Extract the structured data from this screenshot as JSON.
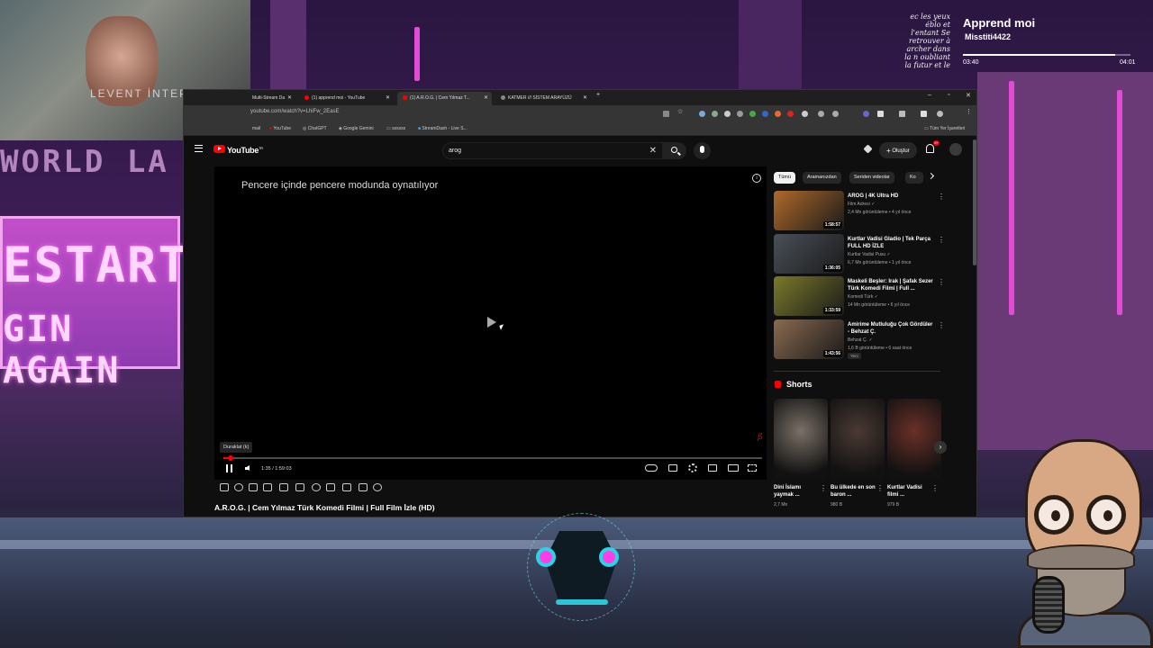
{
  "music": {
    "title": "Apprend moi",
    "artist": "Misstiti4422",
    "current_time": "03:40",
    "total_time": "04:01",
    "progress": 0.91,
    "art_text": "ec les yeux éblo et l'entant Se retrouver à archer dans la n oubliant la futur et le bruit"
  },
  "webcam": {
    "caption": "LEVENT İNTEPE"
  },
  "background": {
    "sign_line1": "ESTART",
    "sign_line2": "GIN AGAIN",
    "top_word": "WORLD LA"
  },
  "browser": {
    "tabs": [
      {
        "label": "Multi-Stream Da"
      },
      {
        "label": "(1) apprend moi - YouTube"
      },
      {
        "label": "(1) A.R.O.G. | Cem Yılmaz T..."
      },
      {
        "label": "KATMER /// SİSTEM ARAYÜZÜ"
      }
    ],
    "new_tab": "+",
    "url": "youtube.com/watch?v=LhiFw_2EasE",
    "bookmarks": [
      {
        "label": "mail"
      },
      {
        "label": "YouTube"
      },
      {
        "label": "ChatGPT"
      },
      {
        "label": "Google Gemini"
      },
      {
        "label": "ssssss"
      },
      {
        "label": "StreamDash - Live S..."
      }
    ],
    "all_bookmarks": "Tüm Yer İşaretleri"
  },
  "youtube": {
    "logo_text": "YouTube",
    "logo_sup": "TR",
    "search_query": "arog",
    "create_label": "Oluştur",
    "notif_count": "9+",
    "player": {
      "pip_message": "Pencere içinde pencere modunda oynatılıyor",
      "tooltip": "Duraklat (k)",
      "current_time": "1:35",
      "duration": "1:59:03",
      "time_display": "1:35 / 1:59:03",
      "progress": 0.013
    },
    "video_title": "A.R.O.G. | Cem Yılmaz Türk Komedi Filmi | Full Film İzle (HD)",
    "chips": [
      "Tümü",
      "Aramanızdan",
      "Seriden videolar",
      "Ko"
    ],
    "recommendations": [
      {
        "title": "AROG | 4K Ultra HD",
        "channel": "Film Adresi",
        "meta": "2,4 Mn görüntüleme • 4 yıl önce",
        "duration": "1:58:57",
        "color": "#b06a2a"
      },
      {
        "title": "Kurtlar Vadisi Gladio | Tek Parça FULL HD İZLE",
        "channel": "Kurtlar Vadisi Pusu",
        "meta": "6,7 Mn görüntüleme • 1 yıl önce",
        "duration": "1:36:05",
        "color": "#4a5058"
      },
      {
        "title": "Maskeli Beşler: Irak | Şafak Sezer Türk Komedi Filmi | Full ...",
        "channel": "Komedi Türk",
        "meta": "14 Mn görüntüleme • 6 yıl önce",
        "duration": "1:33:59",
        "color": "#7a7a2a"
      },
      {
        "title": "Amirime Mutluluğu Çok Gördüler - Behzat Ç.",
        "channel": "Behzat Ç.",
        "meta": "1,6 B görüntüleme • 6 saat önce",
        "duration": "1:43:56",
        "badge": "Yeni",
        "color": "#8a6a50"
      }
    ],
    "shorts_heading": "Shorts",
    "shorts": [
      {
        "title": "Dini İslamı yaymak ...",
        "views": "2,7 Mn",
        "color": "#7a7066"
      },
      {
        "title": "Bu ülkede en son baron ...",
        "views": "980 B",
        "color": "#4a3a34"
      },
      {
        "title": "Kurtlar Vadisi filmi ...",
        "views": "979 B",
        "color": "#6a3028"
      }
    ]
  }
}
